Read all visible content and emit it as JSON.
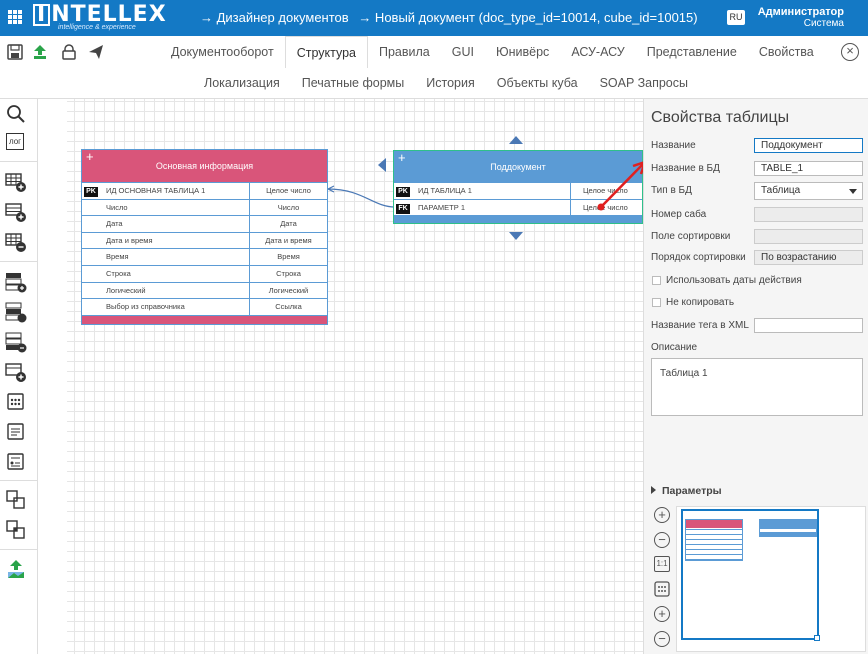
{
  "header": {
    "logo": "NTELLEX",
    "logo_initial": "I",
    "tagline": "intelligence & experience",
    "breadcrumbs": [
      "→ Дизайнер документов",
      "→ Новый документ (doc_type_id=10014, cube_id=10015)"
    ],
    "lang": "RU",
    "user_name": "Администратор",
    "user_role": "Система"
  },
  "tabs": [
    "Документооборот",
    "Структура",
    "Правила",
    "GUI",
    "Юнивёрс",
    "АСУ-АСУ",
    "Представление",
    "Свойства"
  ],
  "active_tab": "Структура",
  "subtabs": [
    "Локализация",
    "Печатные формы",
    "История",
    "Объекты куба",
    "SOAP Запросы"
  ],
  "sidebar": {
    "log_label": "лог"
  },
  "main_table": {
    "title": "Основная информация",
    "header_color": "#d9557a",
    "rows": [
      {
        "key": "PK",
        "name": "ИД ОСНОВНАЯ ТАБЛИЦА 1",
        "type": "Целое число"
      },
      {
        "key": "",
        "name": "Число",
        "type": "Число"
      },
      {
        "key": "",
        "name": "Дата",
        "type": "Дата"
      },
      {
        "key": "",
        "name": "Дата и время",
        "type": "Дата и время"
      },
      {
        "key": "",
        "name": "Время",
        "type": "Время"
      },
      {
        "key": "",
        "name": "Строка",
        "type": "Строка"
      },
      {
        "key": "",
        "name": "Логический",
        "type": "Логический"
      },
      {
        "key": "",
        "name": "Выбор из справочника",
        "type": "Ссылка"
      }
    ]
  },
  "sub_table": {
    "title": "Поддокумент",
    "header_color": "#5b9bd5",
    "rows": [
      {
        "key": "PK",
        "name": "ИД ТАБЛИЦА 1",
        "type": "Целое число"
      },
      {
        "key": "FK",
        "name": "ПАРАМЕТР 1",
        "type": "Целое число"
      }
    ]
  },
  "properties": {
    "title": "Свойства таблицы",
    "name_label": "Название",
    "name_value": "Поддокумент",
    "dbname_label": "Название в БД",
    "dbname_value": "TABLE_1",
    "dbtype_label": "Тип в БД",
    "dbtype_value": "Таблица",
    "saba_label": "Номер саба",
    "sortfield_label": "Поле сортировки",
    "sortorder_label": "Порядок сортировки",
    "sortorder_value": "По возрастанию",
    "use_dates_label": "Использовать даты действия",
    "no_copy_label": "Не копировать",
    "xml_tag_label": "Название тега в XML",
    "desc_label": "Описание",
    "desc_value": "Таблица 1",
    "params_label": "Параметры",
    "zoom_reset_label": "1:1"
  },
  "colors": {
    "accent": "#1479c5",
    "annotation_arrow": "#e02020"
  }
}
